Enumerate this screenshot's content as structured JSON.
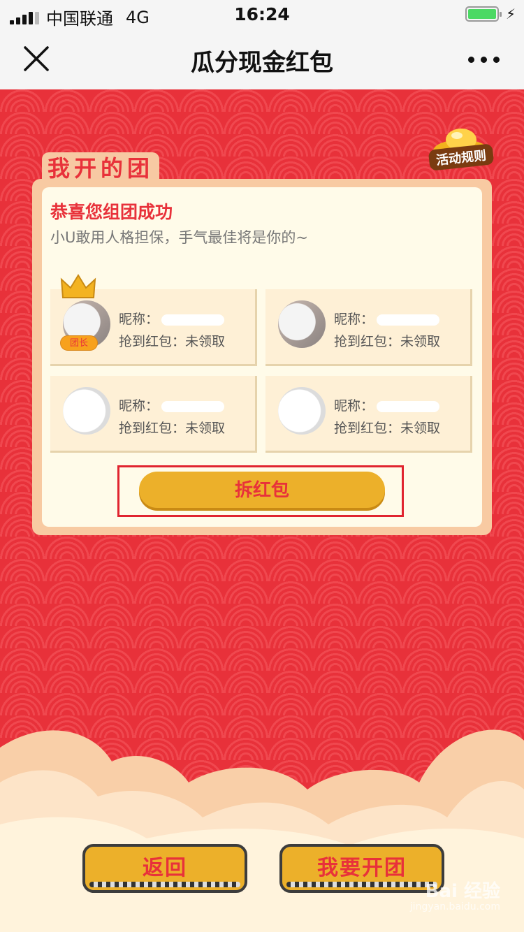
{
  "status_bar": {
    "carrier": "中国联通",
    "network": "4G",
    "time": "16:24"
  },
  "nav": {
    "title": "瓜分现金红包"
  },
  "rules_badge": "活动规则",
  "tab_label": "我开的团",
  "panel": {
    "title": "恭喜您组团成功",
    "subtitle": "小U敢用人格担保，手气最佳将是你的~"
  },
  "members": [
    {
      "nickname_label": "昵称：",
      "redpacket_label": "抢到红包：",
      "redpacket_value": "未领取",
      "badge": "团长"
    },
    {
      "nickname_label": "昵称：",
      "redpacket_label": "抢到红包：",
      "redpacket_value": "未领取"
    },
    {
      "nickname_label": "昵称：",
      "redpacket_label": "抢到红包：",
      "redpacket_value": "未领取"
    },
    {
      "nickname_label": "昵称：",
      "redpacket_label": "抢到红包：",
      "redpacket_value": "未领取"
    }
  ],
  "open_button": "拆红包",
  "buttons": {
    "back": "返回",
    "create": "我要开团"
  },
  "watermark": {
    "brand": "Bai 经验",
    "url": "jingyan.baidu.com"
  },
  "colors": {
    "background": "#e8313a",
    "accent_gold": "#ecb02a",
    "panel_border": "#f8caa2",
    "panel_inner": "#fffbe9"
  }
}
